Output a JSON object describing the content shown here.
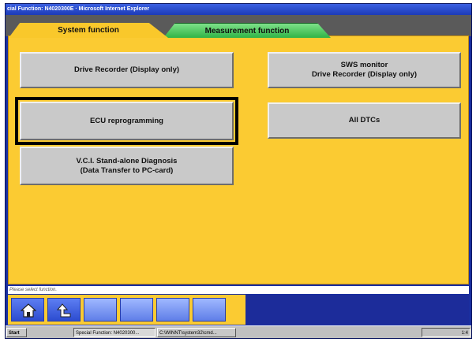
{
  "window": {
    "title": "cial Function: N4020300E · Microsoft Internet Explorer"
  },
  "tabs": [
    {
      "label": "System function",
      "active": true
    },
    {
      "label": "Measurement function",
      "active": false
    }
  ],
  "functions": {
    "drive_recorder": "Drive Recorder (Display only)",
    "ecu_reprogramming": "ECU reprogramming",
    "vci_line1": "V.C.I. Stand-alone Diagnosis",
    "vci_line2": "(Data Transfer to PC-card)",
    "sws_line1": "SWS monitor",
    "sws_line2": "Drive Recorder (Display only)",
    "all_dtcs": "All DTCs"
  },
  "status_text": "Please select function.",
  "toolbar": {
    "home_icon": "home-icon",
    "back_icon": "return-arrow-icon"
  },
  "taskbar": {
    "start": "Start",
    "task1": "Special Function: N4020300...",
    "task2": "C:\\WINNT\\system32\\cmd...",
    "clock": "1:4"
  },
  "colors": {
    "panel": "#fbcb32",
    "system_tab": "#f9c82b",
    "measurement_tab": "#2fb446",
    "frame": "#1a2fa0"
  }
}
